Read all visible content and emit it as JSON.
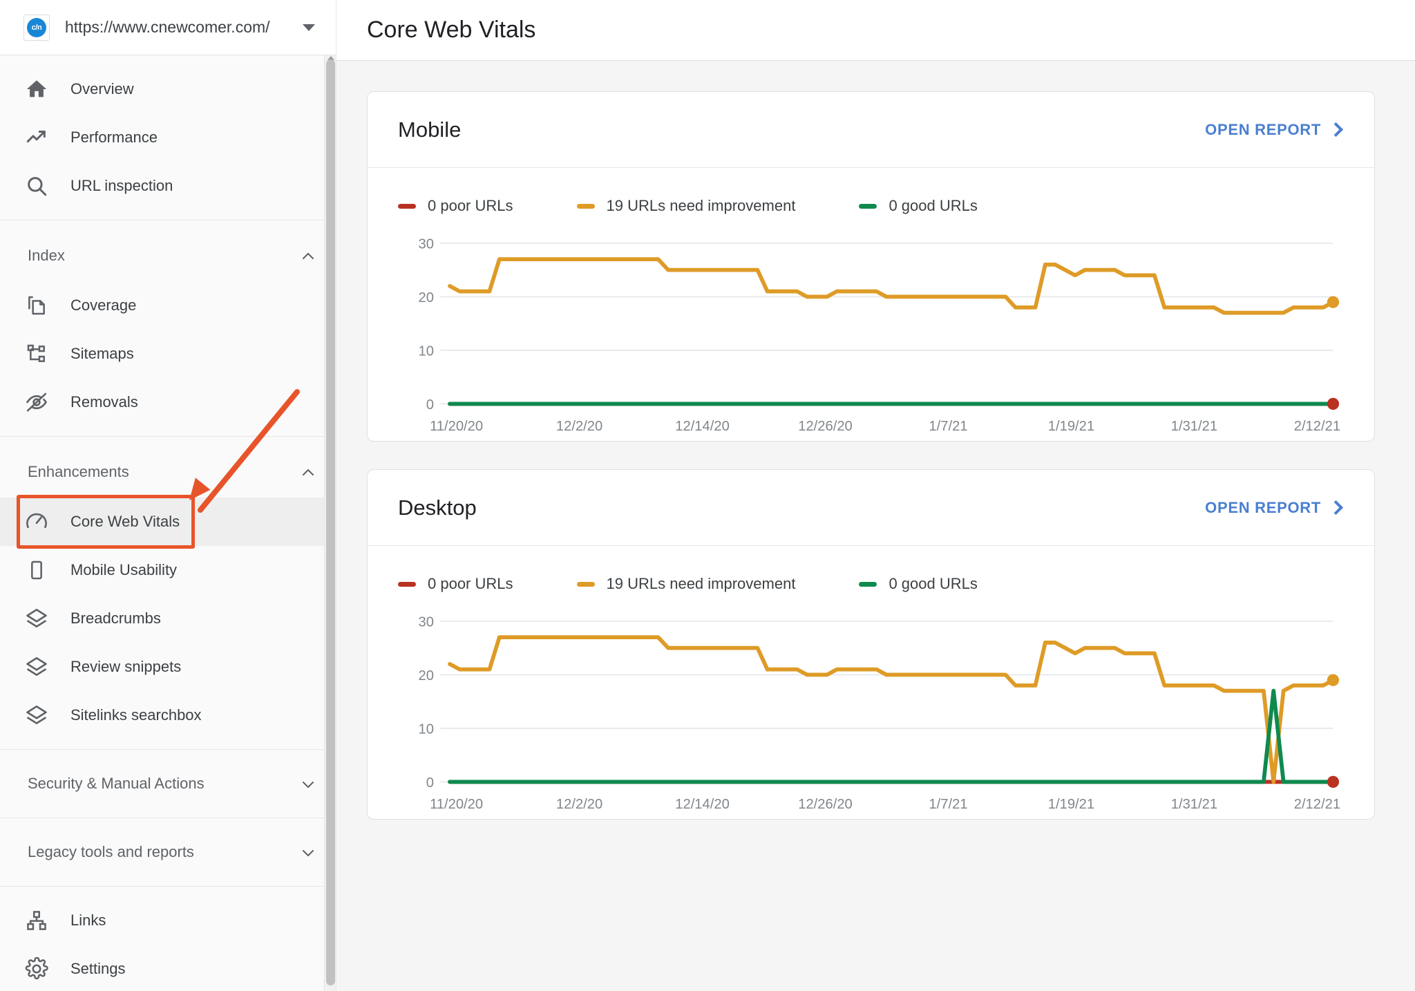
{
  "sidebar": {
    "property": {
      "favicon_text": "c/n",
      "favicon_icon": "site-favicon",
      "url": "https://www.cnewcomer.com/",
      "caret_icon": "chevron-down-icon"
    },
    "top_items": [
      {
        "label": "Overview",
        "icon": "home-icon"
      },
      {
        "label": "Performance",
        "icon": "trending-up-icon"
      },
      {
        "label": "URL inspection",
        "icon": "search-icon"
      }
    ],
    "index_group": {
      "label": "Index",
      "chevron": "chevron-up-icon",
      "items": [
        {
          "label": "Coverage",
          "icon": "copy-document-icon"
        },
        {
          "label": "Sitemaps",
          "icon": "sitemap-icon"
        },
        {
          "label": "Removals",
          "icon": "eye-off-icon"
        }
      ]
    },
    "enhancements_group": {
      "label": "Enhancements",
      "chevron": "chevron-up-icon",
      "items": [
        {
          "label": "Core Web Vitals",
          "icon": "speedometer-icon",
          "active": true
        },
        {
          "label": "Mobile Usability",
          "icon": "mobile-phone-icon",
          "active": false
        },
        {
          "label": "Breadcrumbs",
          "icon": "layers-icon",
          "active": false
        },
        {
          "label": "Review snippets",
          "icon": "layers-icon",
          "active": false
        },
        {
          "label": "Sitelinks searchbox",
          "icon": "layers-icon",
          "active": false
        }
      ]
    },
    "security_group": {
      "label": "Security & Manual Actions",
      "chevron": "chevron-down-icon"
    },
    "legacy_group": {
      "label": "Legacy tools and reports",
      "chevron": "chevron-down-icon"
    },
    "bottom_items": [
      {
        "label": "Links",
        "icon": "links-icon"
      },
      {
        "label": "Settings",
        "icon": "gear-icon"
      }
    ],
    "annotation": {
      "highlight_color": "#e8542a",
      "arrow_color": "#e8542a",
      "target": "Core Web Vitals"
    }
  },
  "header": {
    "title": "Core Web Vitals"
  },
  "cards": [
    {
      "title": "Mobile",
      "open_report_label": "OPEN REPORT",
      "open_report_icon": "chevron-right-icon"
    },
    {
      "title": "Desktop",
      "open_report_label": "OPEN REPORT",
      "open_report_icon": "chevron-right-icon"
    }
  ],
  "colors": {
    "poor": "#b93221",
    "needs_improvement": "#de9b26",
    "good": "#0f8a4f",
    "link": "#4a7fd0",
    "accent_annotation": "#e8542a"
  },
  "chart_data": [
    {
      "type": "line",
      "title": "Mobile",
      "xlabel": "",
      "ylabel": "",
      "ylim": [
        0,
        32
      ],
      "yticks": [
        0,
        10,
        20,
        30
      ],
      "grid": true,
      "legend_position": "top-left",
      "xticks": [
        "11/20/20",
        "12/2/20",
        "12/14/20",
        "12/26/20",
        "1/7/21",
        "1/19/21",
        "1/31/21",
        "2/12/21"
      ],
      "x_start": "11/20/20",
      "x_end": "2/17/21",
      "n_points": 90,
      "series": [
        {
          "name": "0 poor URLs",
          "color": "#b93221",
          "legend_value": 0,
          "end_marker": true,
          "values": [
            0,
            0,
            0,
            0,
            0,
            0,
            0,
            0,
            0,
            0,
            0,
            0,
            0,
            0,
            0,
            0,
            0,
            0,
            0,
            0,
            0,
            0,
            0,
            0,
            0,
            0,
            0,
            0,
            0,
            0,
            0,
            0,
            0,
            0,
            0,
            0,
            0,
            0,
            0,
            0,
            0,
            0,
            0,
            0,
            0,
            0,
            0,
            0,
            0,
            0,
            0,
            0,
            0,
            0,
            0,
            0,
            0,
            0,
            0,
            0,
            0,
            0,
            0,
            0,
            0,
            0,
            0,
            0,
            0,
            0,
            0,
            0,
            0,
            0,
            0,
            0,
            0,
            0,
            0,
            0,
            0,
            0,
            0,
            0,
            0,
            0,
            0,
            0,
            0,
            0
          ]
        },
        {
          "name": "19 URLs need improvement",
          "color": "#de9b26",
          "legend_value": 19,
          "end_marker": true,
          "values": [
            22,
            21,
            21,
            21,
            21,
            27,
            27,
            27,
            27,
            27,
            27,
            27,
            27,
            27,
            27,
            27,
            27,
            27,
            27,
            27,
            27,
            27,
            25,
            25,
            25,
            25,
            25,
            25,
            25,
            25,
            25,
            25,
            21,
            21,
            21,
            21,
            20,
            20,
            20,
            21,
            21,
            21,
            21,
            21,
            20,
            20,
            20,
            20,
            20,
            20,
            20,
            20,
            20,
            20,
            20,
            20,
            20,
            18,
            18,
            18,
            26,
            26,
            25,
            24,
            25,
            25,
            25,
            25,
            24,
            24,
            24,
            24,
            18,
            18,
            18,
            18,
            18,
            18,
            17,
            17,
            17,
            17,
            17,
            17,
            17,
            18,
            18,
            18,
            18,
            19
          ]
        },
        {
          "name": "0 good URLs",
          "color": "#0f8a4f",
          "legend_value": 0,
          "end_marker": false,
          "values": [
            0,
            0,
            0,
            0,
            0,
            0,
            0,
            0,
            0,
            0,
            0,
            0,
            0,
            0,
            0,
            0,
            0,
            0,
            0,
            0,
            0,
            0,
            0,
            0,
            0,
            0,
            0,
            0,
            0,
            0,
            0,
            0,
            0,
            0,
            0,
            0,
            0,
            0,
            0,
            0,
            0,
            0,
            0,
            0,
            0,
            0,
            0,
            0,
            0,
            0,
            0,
            0,
            0,
            0,
            0,
            0,
            0,
            0,
            0,
            0,
            0,
            0,
            0,
            0,
            0,
            0,
            0,
            0,
            0,
            0,
            0,
            0,
            0,
            0,
            0,
            0,
            0,
            0,
            0,
            0,
            0,
            0,
            0,
            0,
            0,
            0,
            0,
            0,
            0,
            0
          ]
        }
      ]
    },
    {
      "type": "line",
      "title": "Desktop",
      "xlabel": "",
      "ylabel": "",
      "ylim": [
        0,
        32
      ],
      "yticks": [
        0,
        10,
        20,
        30
      ],
      "grid": true,
      "legend_position": "top-left",
      "xticks": [
        "11/20/20",
        "12/2/20",
        "12/14/20",
        "12/26/20",
        "1/7/21",
        "1/19/21",
        "1/31/21",
        "2/12/21"
      ],
      "x_start": "11/20/20",
      "x_end": "2/17/21",
      "n_points": 90,
      "annotation": "Orange dips to 0 and green spikes to 17 around 1/31/21, forming a crossing pattern",
      "series": [
        {
          "name": "0 poor URLs",
          "color": "#b93221",
          "legend_value": 0,
          "end_marker": true,
          "values": [
            0,
            0,
            0,
            0,
            0,
            0,
            0,
            0,
            0,
            0,
            0,
            0,
            0,
            0,
            0,
            0,
            0,
            0,
            0,
            0,
            0,
            0,
            0,
            0,
            0,
            0,
            0,
            0,
            0,
            0,
            0,
            0,
            0,
            0,
            0,
            0,
            0,
            0,
            0,
            0,
            0,
            0,
            0,
            0,
            0,
            0,
            0,
            0,
            0,
            0,
            0,
            0,
            0,
            0,
            0,
            0,
            0,
            0,
            0,
            0,
            0,
            0,
            0,
            0,
            0,
            0,
            0,
            0,
            0,
            0,
            0,
            0,
            0,
            0,
            0,
            0,
            0,
            0,
            0,
            0,
            0,
            0,
            0,
            0,
            0,
            0,
            0,
            0,
            0,
            0
          ]
        },
        {
          "name": "19 URLs need improvement",
          "color": "#de9b26",
          "legend_value": 19,
          "end_marker": true,
          "values": [
            22,
            21,
            21,
            21,
            21,
            27,
            27,
            27,
            27,
            27,
            27,
            27,
            27,
            27,
            27,
            27,
            27,
            27,
            27,
            27,
            27,
            27,
            25,
            25,
            25,
            25,
            25,
            25,
            25,
            25,
            25,
            25,
            21,
            21,
            21,
            21,
            20,
            20,
            20,
            21,
            21,
            21,
            21,
            21,
            20,
            20,
            20,
            20,
            20,
            20,
            20,
            20,
            20,
            20,
            20,
            20,
            20,
            18,
            18,
            18,
            26,
            26,
            25,
            24,
            25,
            25,
            25,
            25,
            24,
            24,
            24,
            24,
            18,
            18,
            18,
            18,
            18,
            18,
            17,
            17,
            17,
            17,
            17,
            0,
            17,
            18,
            18,
            18,
            18,
            19
          ]
        },
        {
          "name": "0 good URLs",
          "color": "#0f8a4f",
          "legend_value": 0,
          "end_marker": false,
          "values": [
            0,
            0,
            0,
            0,
            0,
            0,
            0,
            0,
            0,
            0,
            0,
            0,
            0,
            0,
            0,
            0,
            0,
            0,
            0,
            0,
            0,
            0,
            0,
            0,
            0,
            0,
            0,
            0,
            0,
            0,
            0,
            0,
            0,
            0,
            0,
            0,
            0,
            0,
            0,
            0,
            0,
            0,
            0,
            0,
            0,
            0,
            0,
            0,
            0,
            0,
            0,
            0,
            0,
            0,
            0,
            0,
            0,
            0,
            0,
            0,
            0,
            0,
            0,
            0,
            0,
            0,
            0,
            0,
            0,
            0,
            0,
            0,
            0,
            0,
            0,
            0,
            0,
            0,
            0,
            0,
            0,
            0,
            0,
            17,
            0,
            0,
            0,
            0,
            0,
            0
          ]
        }
      ]
    }
  ]
}
